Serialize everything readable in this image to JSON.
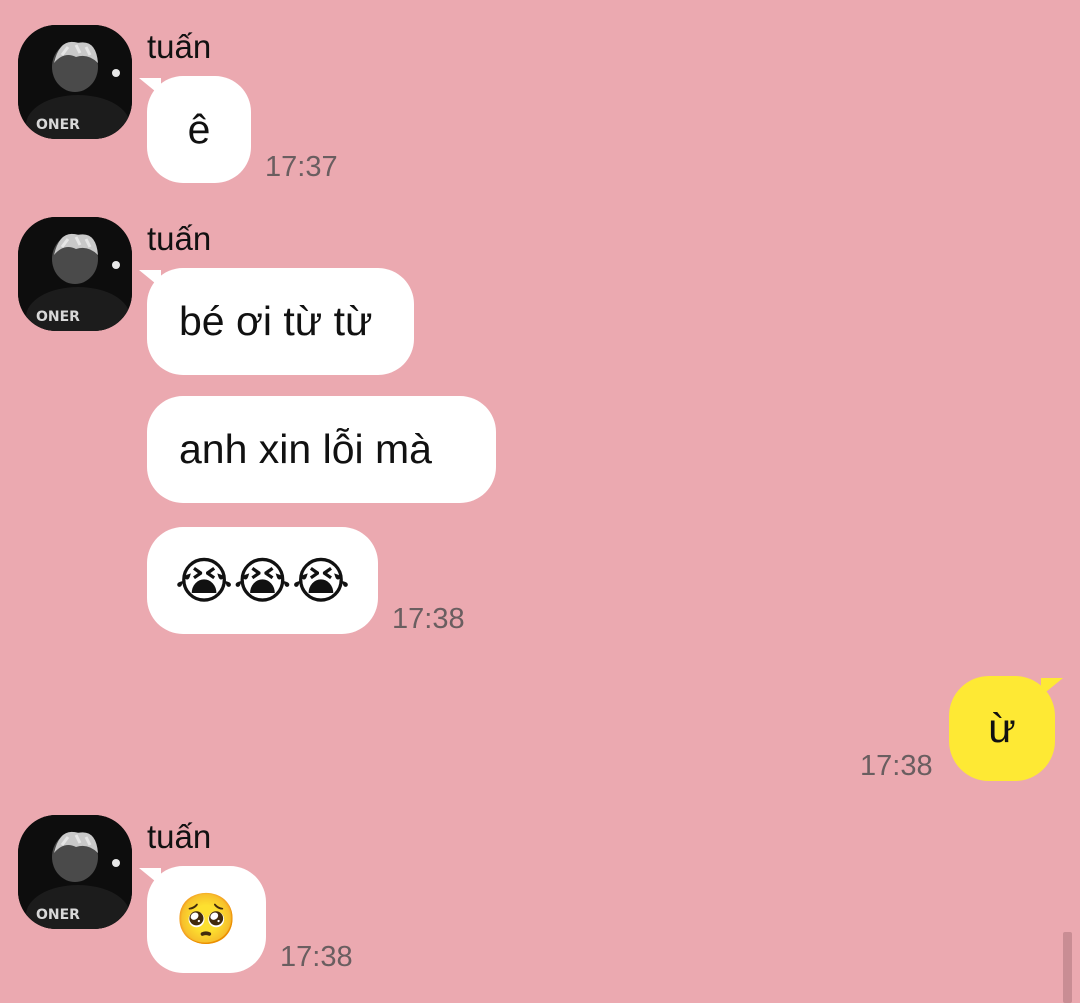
{
  "chat": {
    "contact_name": "tuấn",
    "messages": [
      {
        "from": "tuấn",
        "text": "ê",
        "time": "17:37"
      },
      {
        "from": "tuấn",
        "text": "bé ơi từ từ"
      },
      {
        "from": "tuấn",
        "text": "anh xin lỗi mà"
      },
      {
        "from": "tuấn",
        "text": "😭😭😭",
        "time": "17:38"
      },
      {
        "from": "me",
        "text": "ừ",
        "time": "17:38"
      },
      {
        "from": "tuấn",
        "text": "🥺",
        "time": "17:38"
      }
    ],
    "avatar_icon": "profile-photo-icon",
    "avatar_caption": "ONER"
  },
  "colors": {
    "background": "#eba9b0",
    "incoming_bubble": "#ffffff",
    "outgoing_bubble": "#fee934"
  }
}
